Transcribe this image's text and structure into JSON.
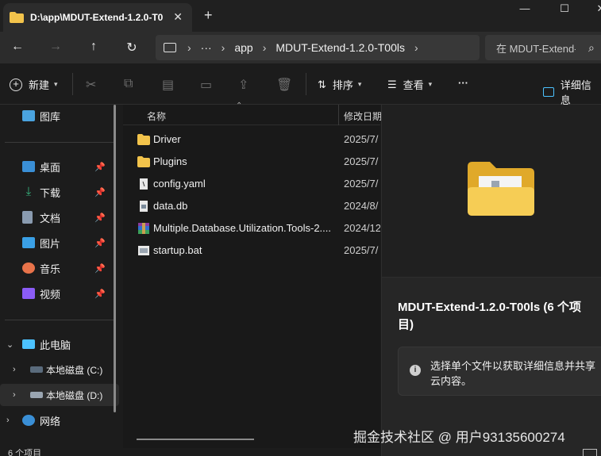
{
  "window": {
    "tab_title": "D:\\app\\MDUT-Extend-1.2.0-T0",
    "tab_close": "✕",
    "new_tab": "+",
    "minimize": "—",
    "maximize": "☐",
    "close": "✕"
  },
  "nav": {
    "back": "←",
    "forward": "→",
    "up": "↑",
    "refresh": "↻",
    "more": "···",
    "chevron": "›",
    "breadcrumbs": [
      "app",
      "MDUT-Extend-1.2.0-T00ls"
    ],
    "search_placeholder": "在 MDUT-Extend-",
    "search_icon": "search-icon"
  },
  "toolbar": {
    "new_label": "新建",
    "sort_label": "排序",
    "view_label": "查看",
    "more_label": "···",
    "details_label": "详细信息"
  },
  "sidebar": {
    "quick": [
      {
        "label": "图库",
        "icon": "gallery-icon",
        "color": "#4aa3df"
      }
    ],
    "pinned": [
      {
        "label": "桌面",
        "icon": "desktop-icon",
        "color": "#3a8fd6"
      },
      {
        "label": "下载",
        "icon": "download-icon",
        "color": "#36b37e"
      },
      {
        "label": "文档",
        "icon": "document-icon",
        "color": "#8a9bb0"
      },
      {
        "label": "图片",
        "icon": "pictures-icon",
        "color": "#3aa0e6"
      },
      {
        "label": "音乐",
        "icon": "music-icon",
        "color": "#e8734a"
      },
      {
        "label": "视频",
        "icon": "video-icon",
        "color": "#8b5cf6"
      }
    ],
    "this_pc": "此电脑",
    "drives": [
      {
        "label": "本地磁盘 (C:)",
        "icon": "drive-c-icon"
      },
      {
        "label": "本地磁盘 (D:)",
        "icon": "drive-d-icon"
      }
    ],
    "network": "网络"
  },
  "filelist": {
    "col_name": "名称",
    "col_modified": "修改日期",
    "rows": [
      {
        "name": "Driver",
        "date": "2025/7/",
        "icon": "folder-icon"
      },
      {
        "name": "Plugins",
        "date": "2025/7/",
        "icon": "folder-icon"
      },
      {
        "name": "config.yaml",
        "date": "2025/7/",
        "icon": "yaml-file-icon"
      },
      {
        "name": "data.db",
        "date": "2024/8/",
        "icon": "db-file-icon"
      },
      {
        "name": "Multiple.Database.Utilization.Tools-2....",
        "date": "2024/12",
        "icon": "archive-file-icon"
      },
      {
        "name": "startup.bat",
        "date": "2025/7/",
        "icon": "bat-file-icon"
      }
    ]
  },
  "details": {
    "title": "MDUT-Extend-1.2.0-T00ls (6 个项目)",
    "info": "选择单个文件以获取详细信息并共享云内容。"
  },
  "status": {
    "items": "6 个项目"
  },
  "watermark": "掘金技术社区 @ 用户93135600274",
  "colors": {
    "folder": "#f2c34b",
    "folder_dark": "#e0a92a",
    "accent": "#4cc2ff"
  }
}
